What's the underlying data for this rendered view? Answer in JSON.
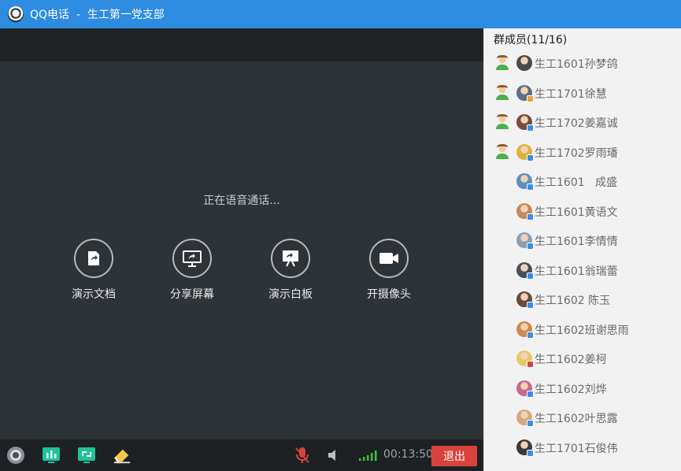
{
  "window": {
    "title": "QQ电话  -  生工第一党支部"
  },
  "call": {
    "status": "正在语音通话...",
    "actions": [
      {
        "label": "演示文档",
        "icon": "share-document-icon"
      },
      {
        "label": "分享屏幕",
        "icon": "share-screen-icon"
      },
      {
        "label": "演示白板",
        "icon": "whiteboard-icon"
      },
      {
        "label": "开摄像头",
        "icon": "camera-icon"
      }
    ]
  },
  "toolbar": {
    "timer": "00:13:50",
    "exit_label": "退出",
    "icons": [
      "webcam-icon",
      "stats-icon",
      "screen-share-icon",
      "eraser-icon",
      "mic-muted-icon",
      "speaker-icon",
      "signal-icon"
    ]
  },
  "members": {
    "header": "群成员(11/16)",
    "list": [
      {
        "name": "生工1601孙梦鸽",
        "online": true,
        "avatar_color": "#4a4a4a",
        "badge_color": ""
      },
      {
        "name": "生工1701徐慧",
        "online": true,
        "avatar_color": "#5f6e86",
        "badge_color": "#e8a33a"
      },
      {
        "name": "生工1702姜嘉诚",
        "online": true,
        "avatar_color": "#7a4a3a",
        "badge_color": "#3a8ee6"
      },
      {
        "name": "生工1702罗雨璠",
        "online": true,
        "avatar_color": "#e0b23a",
        "badge_color": "#3a8ee6"
      },
      {
        "name": "生工1601   成盛",
        "online": false,
        "avatar_color": "#5e8fc0",
        "badge_color": "#3a8ee6"
      },
      {
        "name": "生工1601黄语文",
        "online": false,
        "avatar_color": "#c48a5a",
        "badge_color": "#3a8ee6"
      },
      {
        "name": "生工1601李情情",
        "online": false,
        "avatar_color": "#8aa0b4",
        "badge_color": "#3a8ee6"
      },
      {
        "name": "生工1601翁瑞蕾",
        "online": false,
        "avatar_color": "#4a5058",
        "badge_color": "#3a8ee6"
      },
      {
        "name": "生工1602 陈玉",
        "online": false,
        "avatar_color": "#6a4a3a",
        "badge_color": "#3a8ee6"
      },
      {
        "name": "生工1602班谢思雨",
        "online": false,
        "avatar_color": "#d08a4a",
        "badge_color": "#3a8ee6"
      },
      {
        "name": "生工1602姜柯",
        "online": false,
        "avatar_color": "#e8c86a",
        "badge_color": "#d9423c"
      },
      {
        "name": "生工1602刘烨",
        "online": false,
        "avatar_color": "#c86a8a",
        "badge_color": "#3a8ee6"
      },
      {
        "name": "生工1602叶思露",
        "online": false,
        "avatar_color": "#d8a87a",
        "badge_color": "#3a8ee6"
      },
      {
        "name": "生工1701石俊伟",
        "online": false,
        "avatar_color": "#3a3a3a",
        "badge_color": "#3a8ee6"
      }
    ]
  },
  "colors": {
    "titlebar": "#2d8be0",
    "exit": "#d9423c",
    "online": "#4caf50"
  }
}
